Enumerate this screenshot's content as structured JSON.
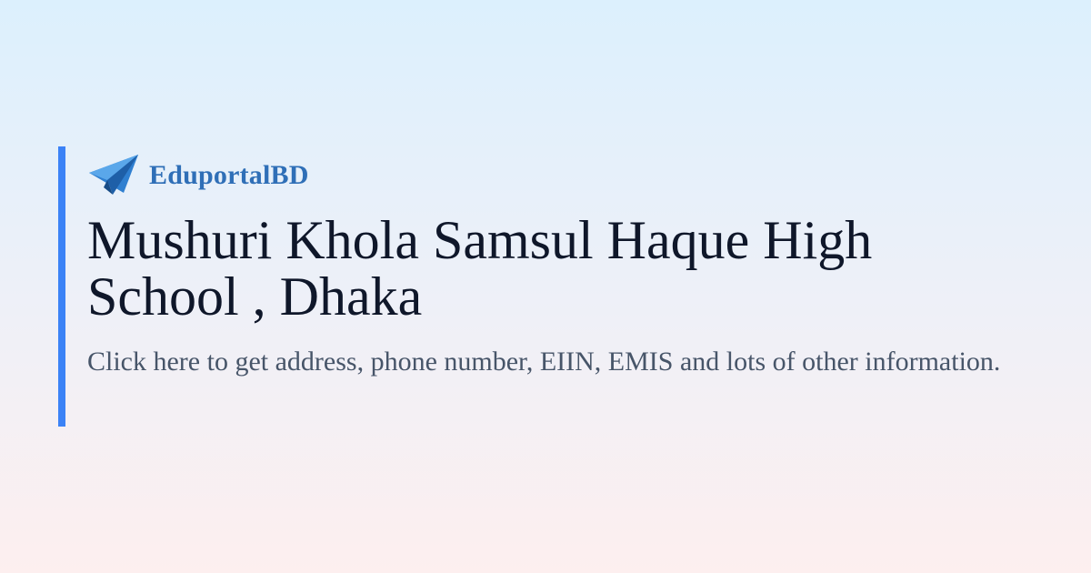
{
  "brand": {
    "name": "EduportalBD",
    "icon": "paper-plane-icon",
    "color": "#2f6fb7"
  },
  "title": "Mushuri Khola Samsul Haque High School , Dhaka",
  "subtitle": "Click here to get address, phone number, EIIN, EMIS and lots of other information.",
  "colors": {
    "accent_bar": "#3b82f6",
    "title": "#0f172a",
    "subtitle": "#475569"
  }
}
